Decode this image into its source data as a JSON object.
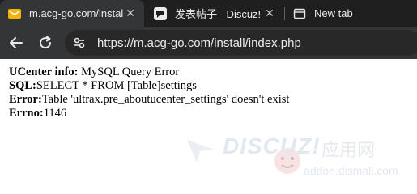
{
  "browser": {
    "tabs": [
      {
        "title": "m.acg-go.com/instal",
        "icon": "envelope-icon",
        "active": true
      },
      {
        "title": "发表帖子 - Discuz! X",
        "icon": "discuz-icon",
        "active": false
      },
      {
        "title": "New tab",
        "icon": "newtab-icon",
        "active": false
      }
    ],
    "url": "https://m.acg-go.com/install/index.php"
  },
  "error": {
    "line1_label": "UCenter info:",
    "line1_text": " MySQL Query Error",
    "line2_label": "SQL:",
    "line2_text": "SELECT * FROM [Table]settings",
    "line3_label": "Error:",
    "line3_text": "Table 'ultrax.pre_aboutucenter_settings' doesn't exist",
    "line4_label": "Errno:",
    "line4_text": "1146"
  },
  "watermark": {
    "brand": "DISCUZ!",
    "cn": "应用网",
    "domain": "addon.dismall.com"
  },
  "colors": {
    "tabbar": "#1f1f1f",
    "toolbar": "#333537",
    "text": "#e8eaed"
  }
}
